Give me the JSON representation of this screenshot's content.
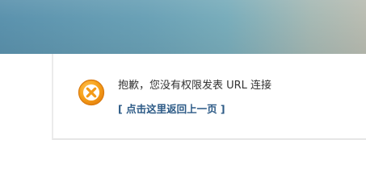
{
  "notice": {
    "message": "抱歉，您没有权限发表 URL 连接",
    "back_link": "[ 点击这里返回上一页 ]",
    "icon": "error-x-icon"
  },
  "colors": {
    "icon_fill": "#f7a21b",
    "icon_border": "#e0841a",
    "link": "#2c5a86",
    "text": "#333333"
  }
}
